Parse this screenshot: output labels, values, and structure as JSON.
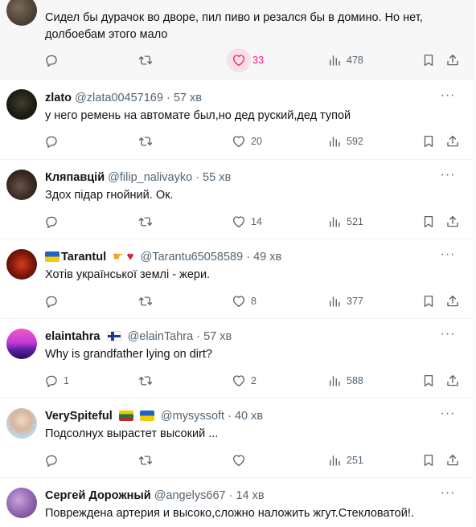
{
  "tweets": [
    {
      "name": "",
      "handle": "",
      "time": "",
      "text": "Сидел бы дурачок во дворе, пил пиво и резался бы в домино. Но нет, долбоебам этого мало",
      "reply_count": "",
      "retweet_count": "",
      "like_count": "33",
      "view_count": "478"
    },
    {
      "name": "zlato",
      "handle": "@zlata00457169",
      "time": "· 57 хв",
      "text": "у него ремень на автомате был,но дед руский,дед тупой",
      "reply_count": "",
      "retweet_count": "",
      "like_count": "20",
      "view_count": "592"
    },
    {
      "name": "Кляпавцій",
      "handle": "@filip_nalivayko",
      "time": "· 55 хв",
      "text": "Здох підар гнойний. Ок.",
      "reply_count": "",
      "retweet_count": "",
      "like_count": "14",
      "view_count": "521"
    },
    {
      "name": "Tarantul",
      "handle": "@Tarantu65058589",
      "time": "· 49 хв",
      "text": "Хотів української землі - жери.",
      "reply_count": "",
      "retweet_count": "",
      "like_count": "8",
      "view_count": "377"
    },
    {
      "name": "elaintahra",
      "handle": "@elainTahra",
      "time": "· 57 хв",
      "text": "Why is grandfather lying on dirt?",
      "reply_count": "1",
      "retweet_count": "",
      "like_count": "2",
      "view_count": "588"
    },
    {
      "name": "VerySpiteful",
      "handle": "@mysyssoft",
      "time": "· 40 хв",
      "text": "Подсолнух вырастет высокий ...",
      "reply_count": "",
      "retweet_count": "",
      "like_count": "",
      "view_count": "251"
    },
    {
      "name": "Сергей Дорожный",
      "handle": "@angelys667",
      "time": "· 14 хв",
      "text": "Повреждена артерия и высоко,сложно наложить жгут.Стекловатой!.",
      "reply_count": "",
      "retweet_count": "",
      "like_count": "",
      "view_count": ""
    }
  ],
  "colors": {
    "like_active": "#f91880",
    "icon_gray": "#536471",
    "text": "#0f1419",
    "hover_bg": "#f7f7f7",
    "divider": "#eff3f4"
  },
  "icons": [
    "reply-icon",
    "retweet-icon",
    "like-icon",
    "views-icon",
    "bookmark-icon",
    "share-icon",
    "more-icon"
  ]
}
